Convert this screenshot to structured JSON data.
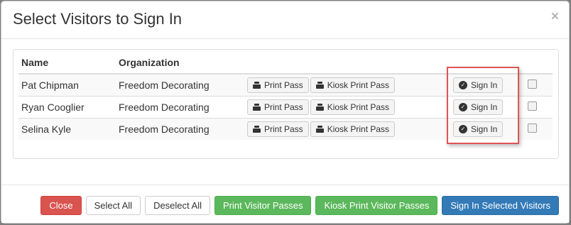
{
  "modal": {
    "title": "Select Visitors to Sign In",
    "close_glyph": "×"
  },
  "table": {
    "headers": {
      "name": "Name",
      "organization": "Organization"
    },
    "rows": [
      {
        "name": "Pat Chipman",
        "organization": "Freedom Decorating",
        "print_label": "Print Pass",
        "kiosk_label": "Kiosk Print Pass",
        "signin_label": "Sign In",
        "checked": false
      },
      {
        "name": "Ryan Cooglier",
        "organization": "Freedom Decorating",
        "print_label": "Print Pass",
        "kiosk_label": "Kiosk Print Pass",
        "signin_label": "Sign In",
        "checked": false
      },
      {
        "name": "Selina Kyle",
        "organization": "Freedom Decorating",
        "print_label": "Print Pass",
        "kiosk_label": "Kiosk Print Pass",
        "signin_label": "Sign In",
        "checked": false
      }
    ]
  },
  "footer": {
    "close_label": "Close",
    "select_all_label": "Select All",
    "deselect_all_label": "Deselect All",
    "print_passes_label": "Print Visitor Passes",
    "kiosk_passes_label": "Kiosk Print Visitor Passes",
    "sign_in_selected_label": "Sign In Selected Visitors"
  },
  "icons": {
    "print": "printer-icon",
    "sign_in": "check-circle-icon",
    "close": "close-icon"
  },
  "colors": {
    "danger": "#d9534f",
    "success": "#5cb85c",
    "primary": "#337ab7",
    "highlight": "#e05454",
    "backdrop": "#7f7f7f"
  }
}
